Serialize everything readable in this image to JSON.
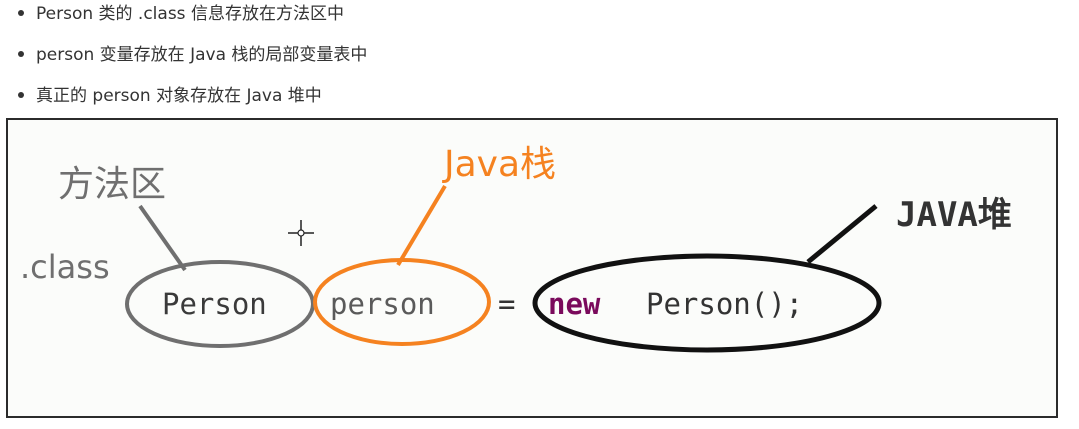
{
  "bullets": [
    "Person 类的 .class 信息存放在方法区中",
    "person 变量存放在 Java 栈的局部变量表中",
    "真正的 person 对象存放在 Java 堆中"
  ],
  "diagram": {
    "label_method_area": "方法区",
    "label_class": ".class",
    "label_java_stack": "Java栈",
    "label_java_heap": "JAVA堆",
    "code_type": "Person",
    "code_var": "person",
    "code_eq": "=",
    "code_new": "new",
    "code_ctor": "Person();",
    "colors": {
      "gray": "#6f6f6f",
      "orange": "#f58220",
      "black": "#111111",
      "keyword": "#7a0a5c"
    }
  }
}
